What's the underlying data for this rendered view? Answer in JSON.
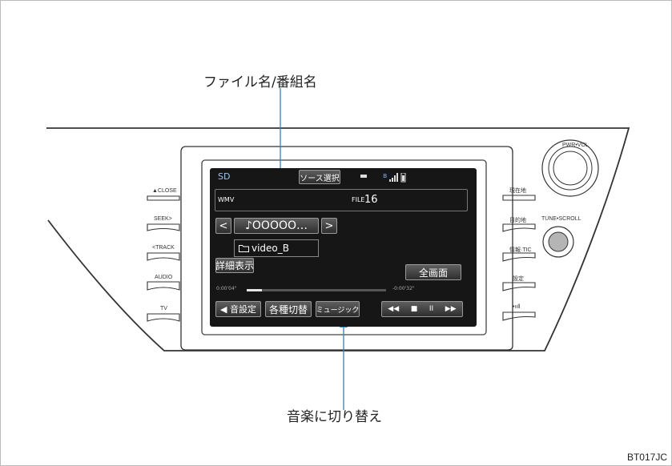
{
  "labels": {
    "file_track_name": "ファイル名/番組名",
    "music_switch": "音楽に切り替え",
    "figure_code": "BT017JC"
  },
  "hard_keys": {
    "left": [
      "▲CLOSE",
      "SEEK>",
      "<TRACK",
      "AUDIO",
      "TV"
    ],
    "right": [
      "現在地",
      "目的地",
      "情報·TIC",
      "設定",
      "•ııll"
    ],
    "knob_top": "PWR•VOL",
    "knob_bottom": "TUNE•SCROLL"
  },
  "screen": {
    "source": "SD",
    "source_select": "ソース選択",
    "format": "WMV",
    "file_label": "FILE",
    "file_number": "16",
    "prev": "<",
    "track_name": "♪OOOOO…",
    "next": ">",
    "folder_name": "video_B",
    "detail_button": "詳細表示",
    "fullscreen_button": "全画面",
    "time_elapsed": "0:00'04\"",
    "time_remaining": "-0:00'32\"",
    "progress": 0.11,
    "sound_settings": "◀ 音設定",
    "switch_types": "各種切替",
    "music_button": "ミュージック",
    "transport": [
      "◀◀",
      "■",
      "II",
      "▶▶"
    ]
  },
  "colors": {
    "accent": "#3b7fae",
    "screen_bg": "#161616"
  }
}
